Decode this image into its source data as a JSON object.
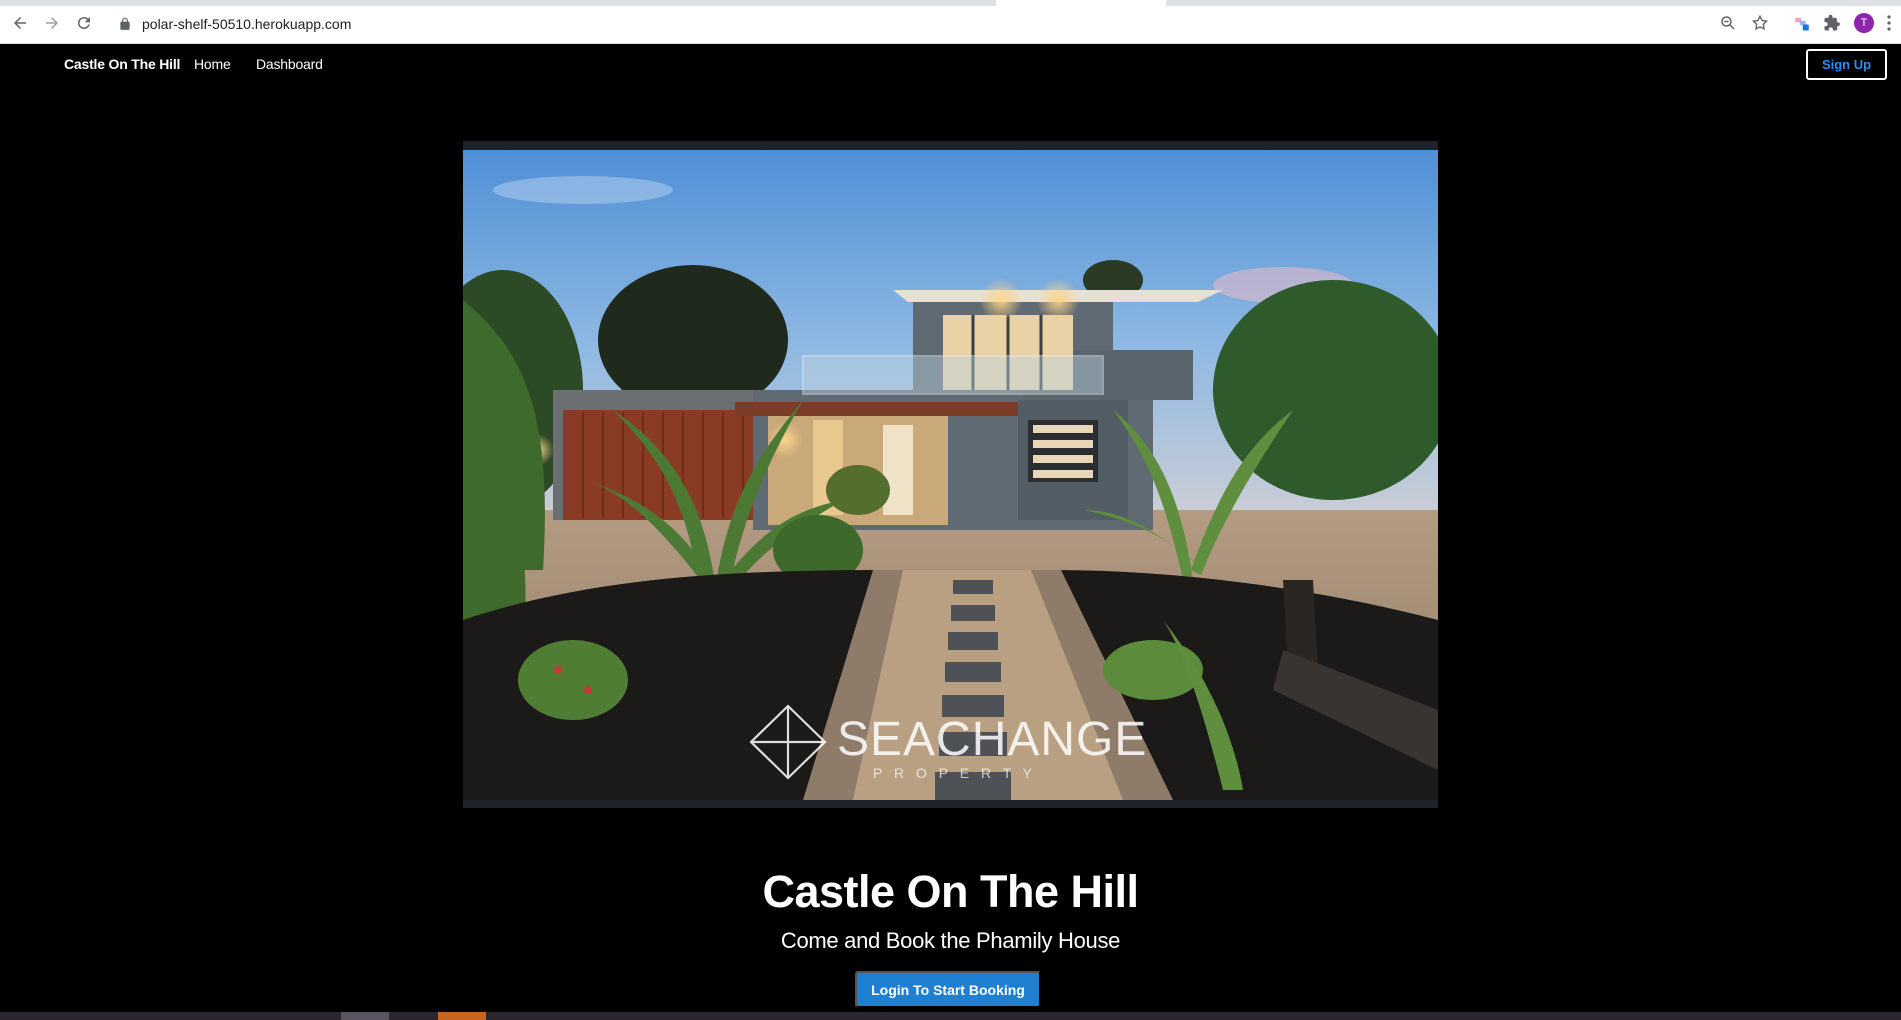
{
  "browser": {
    "url": "polar-shelf-50510.herokuapp.com",
    "profile_initial": "T",
    "icons": {
      "back": "arrow-left-icon",
      "forward": "arrow-right-icon",
      "reload": "reload-icon",
      "lock": "lock-icon",
      "zoom": "zoom-icon",
      "bookmark": "star-icon",
      "extension_badge": "extension-badge-icon",
      "extensions": "puzzle-icon",
      "menu": "kebab-menu-icon"
    }
  },
  "navbar": {
    "brand": "Castle On The Hill",
    "links": [
      "Home",
      "Dashboard"
    ],
    "signup_label": "Sign Up"
  },
  "hero": {
    "watermark_main": "SEACHANGE",
    "watermark_sub": "P R O P E R T Y"
  },
  "main": {
    "title": "Castle On The Hill",
    "subtitle": "Come and Book the Phamily House",
    "cta_label": "Login To Start Booking"
  },
  "colors": {
    "background": "#000000",
    "cta": "#1f7fd1",
    "signup_text": "#2d8cf0",
    "avatar": "#8e24aa"
  }
}
